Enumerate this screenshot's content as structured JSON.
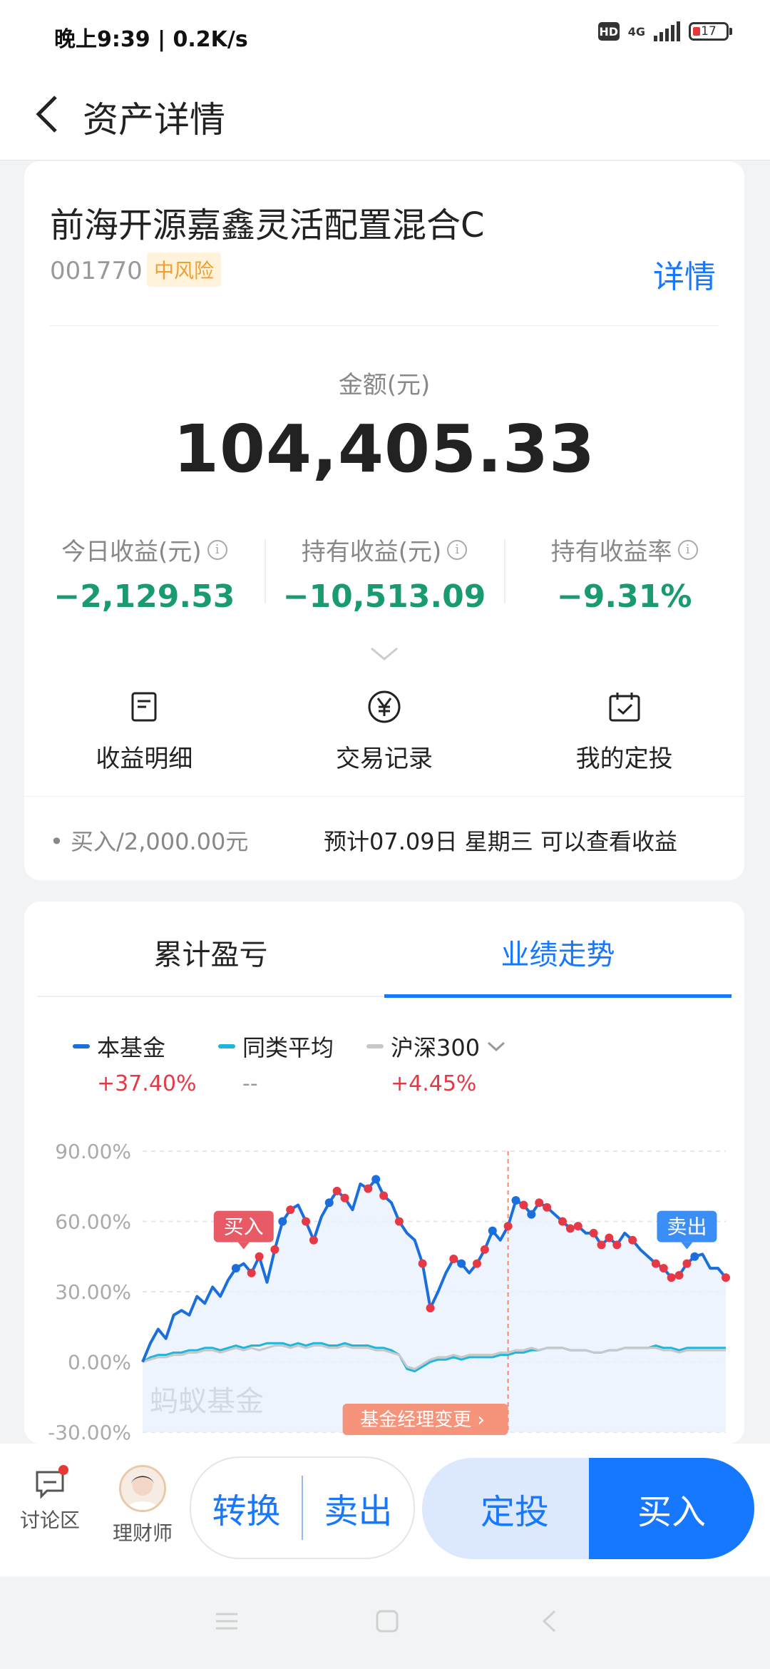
{
  "status": {
    "time": "晚上9:39 | 0.2K/s",
    "hd": "HD",
    "network": "4G",
    "battery": "17"
  },
  "header": {
    "title": "资产详情"
  },
  "fund": {
    "name": "前海开源嘉鑫灵活配置混合C",
    "code": "001770",
    "risk": "中风险",
    "detail_link": "详情",
    "amount_label": "金额(元)",
    "amount": "104,405.33",
    "stats": [
      {
        "label": "今日收益(元)",
        "value": "−2,129.53"
      },
      {
        "label": "持有收益(元)",
        "value": "−10,513.09"
      },
      {
        "label": "持有收益率",
        "value": "−9.31%"
      }
    ],
    "actions": [
      {
        "label": "收益明细",
        "icon": "document-icon"
      },
      {
        "label": "交易记录",
        "icon": "yen-circle-icon"
      },
      {
        "label": "我的定投",
        "icon": "calendar-check-icon"
      }
    ],
    "buy_info": "买入/2,000.00元",
    "buy_note": "预计07.09日 星期三 可以查看收益"
  },
  "chart_section": {
    "tabs": [
      "累计盈亏",
      "业绩走势"
    ],
    "active_tab": 1,
    "legend": [
      {
        "name": "本基金",
        "pct": "+37.40%",
        "color": "#1a6fdc"
      },
      {
        "name": "同类平均",
        "pct": "--",
        "color": "#1fb6d9"
      },
      {
        "name": "沪深300",
        "pct": "+4.45%",
        "color": "#c8c8c8"
      }
    ],
    "watermark": "蚂蚁基金",
    "manager_change": "基金经理变更",
    "buy_tag": "买入",
    "sell_tag": "卖出"
  },
  "chart_data": {
    "type": "line",
    "ylim": [
      -30,
      90
    ],
    "yticks": [
      "90.00%",
      "60.00%",
      "30.00%",
      "0.00%",
      "-30.00%"
    ],
    "ytick_values": [
      90,
      60,
      30,
      0,
      -30
    ],
    "series": [
      {
        "name": "本基金",
        "color": "#1a6fdc",
        "values": [
          0,
          8,
          14,
          10,
          20,
          22,
          20,
          28,
          25,
          32,
          28,
          35,
          40,
          42,
          38,
          45,
          34,
          48,
          60,
          65,
          67,
          60,
          52,
          62,
          68,
          73,
          70,
          65,
          76,
          74,
          78,
          71,
          68,
          60,
          55,
          52,
          42,
          23,
          30,
          38,
          44,
          42,
          38,
          42,
          48,
          56,
          52,
          58,
          69,
          67,
          63,
          68,
          66,
          63,
          60,
          57,
          58,
          55,
          55,
          50,
          53,
          50,
          55,
          52,
          48,
          45,
          42,
          40,
          36,
          37,
          42,
          45,
          46,
          40,
          40,
          36
        ]
      },
      {
        "name": "沪深300",
        "color": "#c8c8c8",
        "values": [
          0,
          1,
          2,
          2,
          3,
          3,
          4,
          4,
          5,
          5,
          4,
          5,
          6,
          5,
          6,
          5,
          6,
          7,
          7,
          6,
          7,
          6,
          7,
          7,
          6,
          6,
          7,
          6,
          6,
          6,
          5,
          5,
          4,
          3,
          -2,
          -3,
          -1,
          1,
          2,
          2,
          3,
          2,
          3,
          3,
          3,
          3,
          4,
          4,
          5,
          5,
          6,
          5,
          6,
          6,
          6,
          5,
          5,
          5,
          4,
          4,
          5,
          5,
          6,
          6,
          6,
          6,
          6,
          5,
          5,
          4,
          5,
          5,
          5,
          5,
          5,
          5
        ]
      },
      {
        "name": "同类平均",
        "color": "#1fb6d9",
        "values": [
          0,
          2,
          3,
          3,
          4,
          4,
          5,
          5,
          6,
          6,
          5,
          6,
          7,
          6,
          7,
          7,
          8,
          8,
          8,
          7,
          8,
          7,
          8,
          8,
          7,
          7,
          8,
          7,
          7,
          7,
          6,
          6,
          5,
          3,
          -3,
          -4,
          -2,
          0,
          1,
          1,
          2,
          1,
          2,
          2,
          2,
          2,
          3,
          3,
          4,
          4,
          5,
          5,
          6,
          6,
          6,
          5,
          5,
          5,
          4,
          4,
          5,
          5,
          6,
          6,
          6,
          6,
          7,
          6,
          6,
          5,
          6,
          6,
          6,
          6,
          6,
          6
        ]
      }
    ],
    "buy_marker_index": 13,
    "sell_marker_index": 70,
    "manager_change_index": 47
  },
  "bottom": {
    "discuss": "讨论区",
    "advisor": "理财师",
    "convert": "转换",
    "sell": "卖出",
    "sip": "定投",
    "buy": "买入"
  }
}
